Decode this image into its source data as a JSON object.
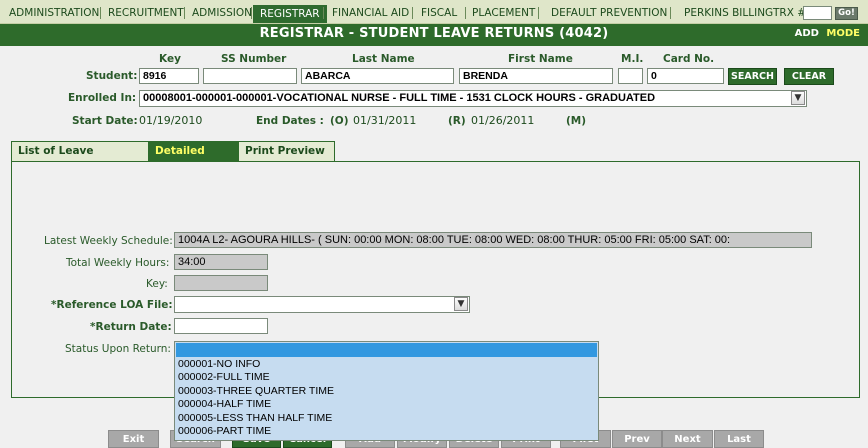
{
  "nav": {
    "items": [
      "ADMINISTRATION",
      "RECRUITMENT",
      "ADMISSION",
      "REGISTRAR",
      "FINANCIAL AID",
      "FISCAL",
      "PLACEMENT",
      "DEFAULT PREVENTION",
      "PERKINS BILLING"
    ],
    "active": "REGISTRAR",
    "trx_label": "TRX #:",
    "trx_value": "",
    "go_label": "Go!"
  },
  "header": {
    "title": "REGISTRAR - STUDENT LEAVE RETURNS (4042)",
    "mode_prefix": "ADD",
    "mode_label": "MODE"
  },
  "student": {
    "label": "Student:",
    "col_key": "Key",
    "col_ssn": "SS Number",
    "col_last": "Last Name",
    "col_first": "First Name",
    "col_mi": "M.I.",
    "col_card": "Card No.",
    "key": "8916",
    "ssn": "",
    "last_name": "ABARCA",
    "first_name": "BRENDA",
    "mi": "",
    "card_no": "0",
    "search_label": "SEARCH",
    "clear_label": "CLEAR"
  },
  "enrollment": {
    "label": "Enrolled In:",
    "value": "00008001-000001-000001-VOCATIONAL NURSE - FULL TIME - 1531 CLOCK HOURS - GRADUATED",
    "start_label": "Start Date:",
    "start_date": "01/19/2010",
    "end_label": "End Dates :",
    "o_label": "(O)",
    "o_date": "01/31/2011",
    "r_label": "(R)",
    "r_date": "01/26/2011",
    "m_label": "(M)"
  },
  "tabs": [
    "List of Leave Returns",
    "Detailed Info",
    "Print Preview"
  ],
  "form": {
    "schedule_label": "Latest Weekly Schedule:",
    "schedule_value": "1004A L2- AGOURA HILLS- ( SUN: 00:00 MON: 08:00 TUE: 08:00 WED: 08:00 THUR: 05:00 FRI: 05:00 SAT: 00:",
    "hours_label": "Total Weekly Hours:",
    "hours_value": "34:00",
    "key_label": "Key:",
    "key_value": "",
    "loa_label": "*Reference LOA File:",
    "loa_value": "",
    "return_label": "*Return Date:",
    "return_value": "",
    "status_label": "Status Upon Return:",
    "status_options": [
      "",
      "000001-NO INFO",
      "000002-FULL TIME",
      "000003-THREE QUARTER TIME",
      "000004-HALF TIME",
      "000005-LESS THAN HALF TIME",
      "000006-PART TIME"
    ]
  },
  "toolbar": {
    "exit": "Exit",
    "search": "Search",
    "save": "Save",
    "cancel": "Cancel",
    "add": "Add",
    "modify": "Modify",
    "delete": "Delete",
    "print": "Print",
    "first": "First",
    "prev": "Prev",
    "next": "Next",
    "last": "Last"
  },
  "colors": {
    "brand_green": "#2e6b2b",
    "nav_bg": "#dfe6c9",
    "dropdown_highlight": "#3298e0",
    "dropdown_bg": "#c6dcf0"
  }
}
